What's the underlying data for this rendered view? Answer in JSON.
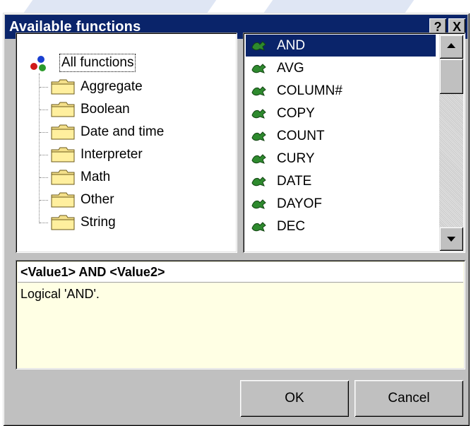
{
  "window": {
    "title": "Available functions",
    "help_button": "?",
    "close_button": "X"
  },
  "categories": {
    "root": "All functions",
    "items": [
      "Aggregate",
      "Boolean",
      "Date and time",
      "Interpreter",
      "Math",
      "Other",
      "String"
    ]
  },
  "functions": {
    "selected": "AND",
    "items": [
      "AND",
      "AVG",
      "COLUMN#",
      "COPY",
      "COUNT",
      "CURY",
      "DATE",
      "DAYOF",
      "DEC"
    ]
  },
  "description": {
    "signature": "<Value1> AND <Value2>",
    "text": "Logical 'AND'."
  },
  "buttons": {
    "ok": "OK",
    "cancel": "Cancel"
  },
  "colors": {
    "titlebar": "#0a246a",
    "dialog_face": "#c0c0c0",
    "selection": "#0a246a",
    "description_background": "#ffffe4"
  }
}
